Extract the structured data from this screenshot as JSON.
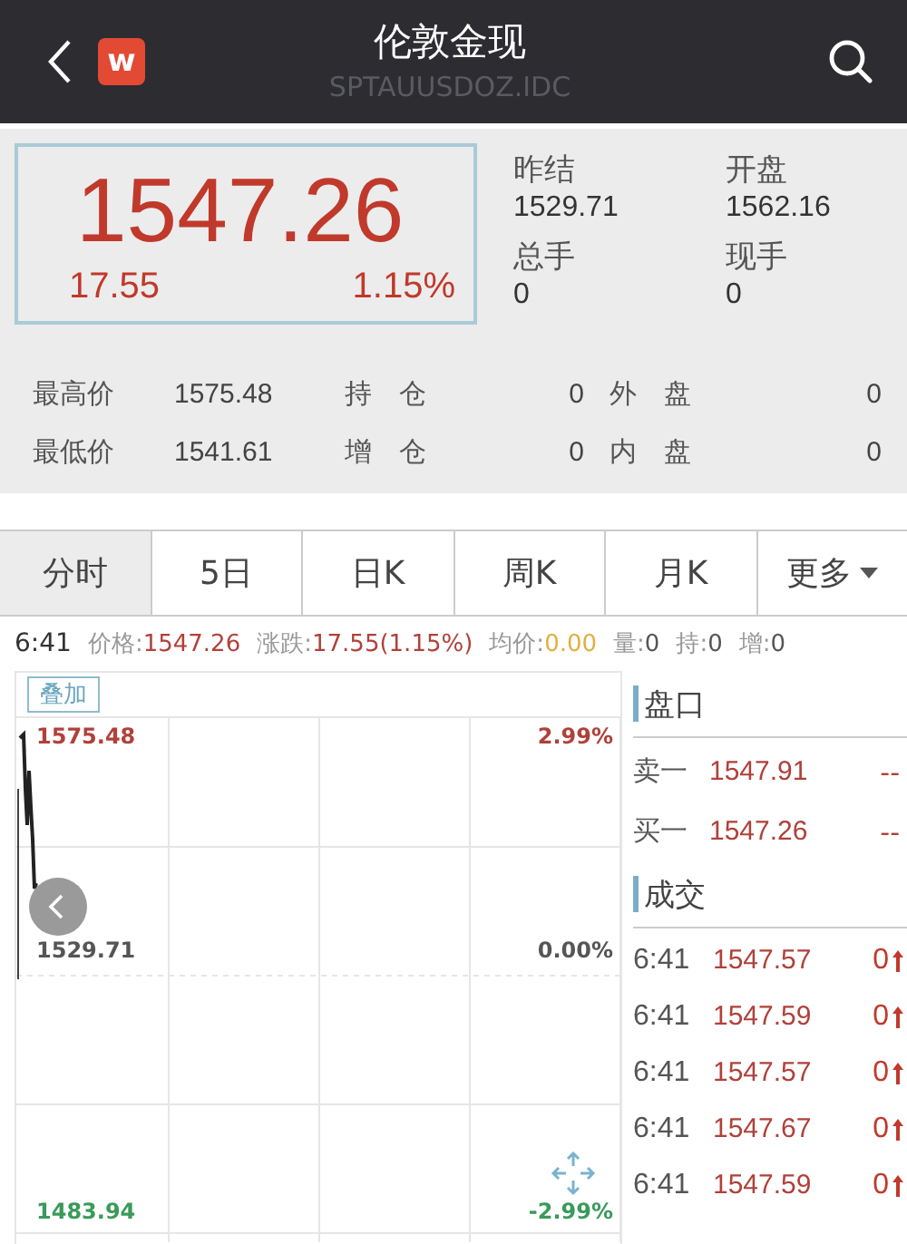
{
  "header": {
    "title": "伦敦金现",
    "subtitle": "SPTAUUSDOZ.IDC",
    "logo": "w"
  },
  "quote": {
    "price": "1547.26",
    "change": "17.55",
    "percent": "1.15%",
    "stats": [
      {
        "label": "昨结",
        "value": "1529.71"
      },
      {
        "label": "开盘",
        "value": "1562.16"
      },
      {
        "label": "总手",
        "value": "0"
      },
      {
        "label": "现手",
        "value": "0"
      }
    ]
  },
  "details": [
    [
      {
        "label": "最高价",
        "value": "1575.48"
      },
      {
        "label": "持　仓",
        "value": "0"
      },
      {
        "label": "外　盘",
        "value": "0"
      }
    ],
    [
      {
        "label": "最低价",
        "value": "1541.61"
      },
      {
        "label": "增　仓",
        "value": "0"
      },
      {
        "label": "内　盘",
        "value": "0"
      }
    ]
  ],
  "tabs": [
    {
      "label": "分时",
      "selected": true
    },
    {
      "label": "5日",
      "selected": false
    },
    {
      "label": "日K",
      "selected": false
    },
    {
      "label": "周K",
      "selected": false
    },
    {
      "label": "月K",
      "selected": false
    },
    {
      "label": "更多",
      "selected": false,
      "kind": "menu"
    }
  ],
  "info": {
    "time": "6:41",
    "items": [
      {
        "label": "价格:",
        "value": "1547.26",
        "color": "#b0413a"
      },
      {
        "label": "涨跌:",
        "value": "17.55(1.15%)",
        "color": "#b0413a"
      },
      {
        "label": "均价:",
        "value": "0.00",
        "color": "#e0b040"
      },
      {
        "label": "量:",
        "value": "0",
        "color": "#555555"
      },
      {
        "label": "持:",
        "value": "0",
        "color": "#555555"
      },
      {
        "label": "增:",
        "value": "0",
        "color": "#555555"
      }
    ]
  },
  "chart": {
    "overlay_button": "叠加",
    "left_labels": [
      {
        "text": "1575.48",
        "color": "#b0413a"
      },
      {
        "text": "1529.71",
        "color": "#555555"
      },
      {
        "text": "1483.94",
        "color": "#3a9a5a"
      }
    ],
    "right_labels": [
      {
        "text": "2.99%",
        "color": "#b0413a"
      },
      {
        "text": "0.00%",
        "color": "#555555"
      },
      {
        "text": "-2.99%",
        "color": "#3a9a5a"
      }
    ]
  },
  "order_book": {
    "title": "盘口",
    "rows": [
      {
        "label": "卖一",
        "price": "1547.91",
        "volume": "--"
      },
      {
        "label": "买一",
        "price": "1547.26",
        "volume": "--"
      }
    ]
  },
  "trades": {
    "title": "成交",
    "rows": [
      {
        "time": "6:41",
        "price": "1547.57",
        "volume": "0"
      },
      {
        "time": "6:41",
        "price": "1547.59",
        "volume": "0"
      },
      {
        "time": "6:41",
        "price": "1547.57",
        "volume": "0"
      },
      {
        "time": "6:41",
        "price": "1547.67",
        "volume": "0"
      },
      {
        "time": "6:41",
        "price": "1547.59",
        "volume": "0"
      }
    ]
  }
}
